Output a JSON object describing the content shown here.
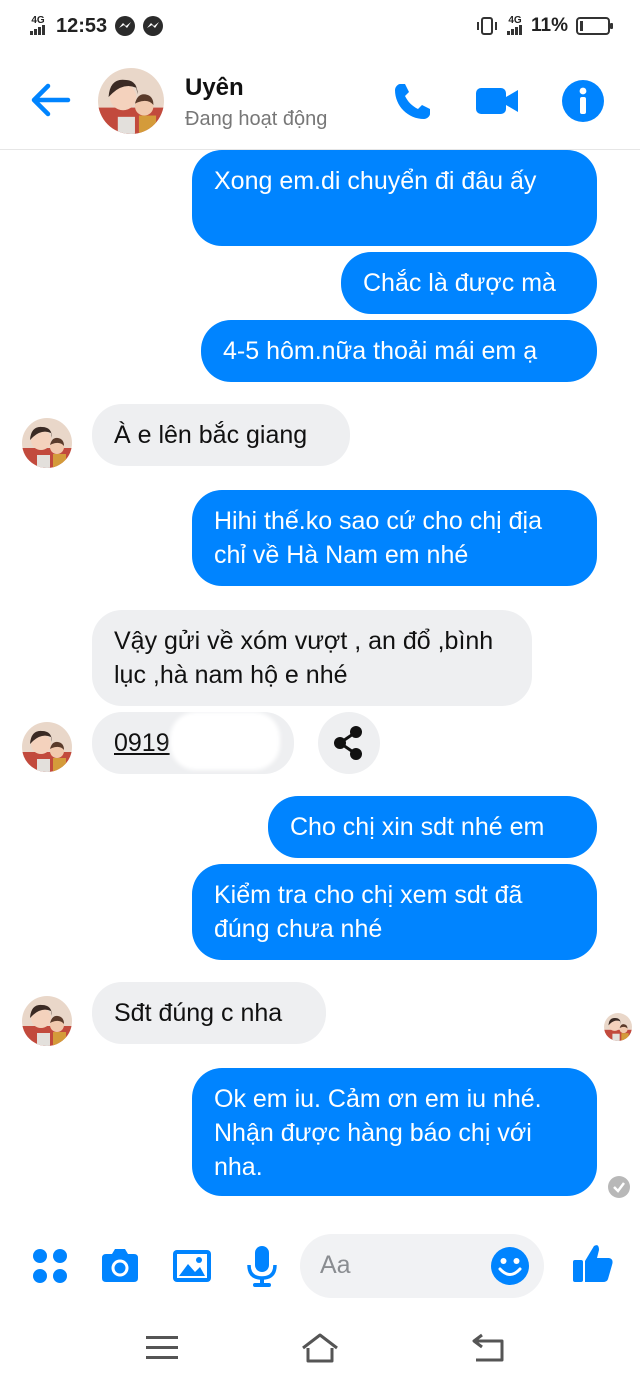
{
  "status_bar": {
    "network_left": "4G",
    "time": "12:53",
    "network_right": "4G",
    "battery_level": 0.11,
    "battery_text": "11%"
  },
  "header": {
    "contact_name": "Uyên",
    "contact_status": "Đang hoạt động"
  },
  "messages": [
    {
      "direction": "out",
      "text": "Xong em.di chuyển đi đâu ấy"
    },
    {
      "direction": "out",
      "text": "Chắc là được mà"
    },
    {
      "direction": "out",
      "text": "4-5 hôm.nữa thoải mái em ạ"
    },
    {
      "direction": "in",
      "text": "À e lên bắc giang"
    },
    {
      "direction": "out",
      "text": "Hihi thế.ko sao cứ cho chị địa chỉ về Hà Nam em nhé"
    },
    {
      "direction": "in",
      "text": "Vậy gửi về xóm vượt , an đổ ,bình lục ,hà nam hộ e nhé"
    },
    {
      "direction": "in",
      "text": "0919",
      "type": "phone-link"
    },
    {
      "direction": "out",
      "text": "Cho chị xin sdt nhé em"
    },
    {
      "direction": "out",
      "text": "Kiểm tra cho chị xem sdt đã đúng chưa nhé"
    },
    {
      "direction": "in",
      "text": "Sđt đúng c nha"
    },
    {
      "direction": "out",
      "text": "Ok em iu. Cảm ơn em iu nhé. Nhận được hàng báo chị với nha."
    }
  ],
  "composer": {
    "placeholder": "Aa"
  },
  "icons": {
    "back": "arrow-left-icon",
    "call": "phone-icon",
    "video": "video-camera-icon",
    "info": "info-icon",
    "share": "share-icon",
    "more": "four-dots-icon",
    "camera": "camera-icon",
    "gallery": "image-icon",
    "mic": "microphone-icon",
    "emoji": "smiley-icon",
    "like": "thumbs-up-icon"
  },
  "colors": {
    "accent": "#0084ff",
    "outgoing_bubble": "#0084ff",
    "incoming_bubble": "#eeeff1"
  }
}
